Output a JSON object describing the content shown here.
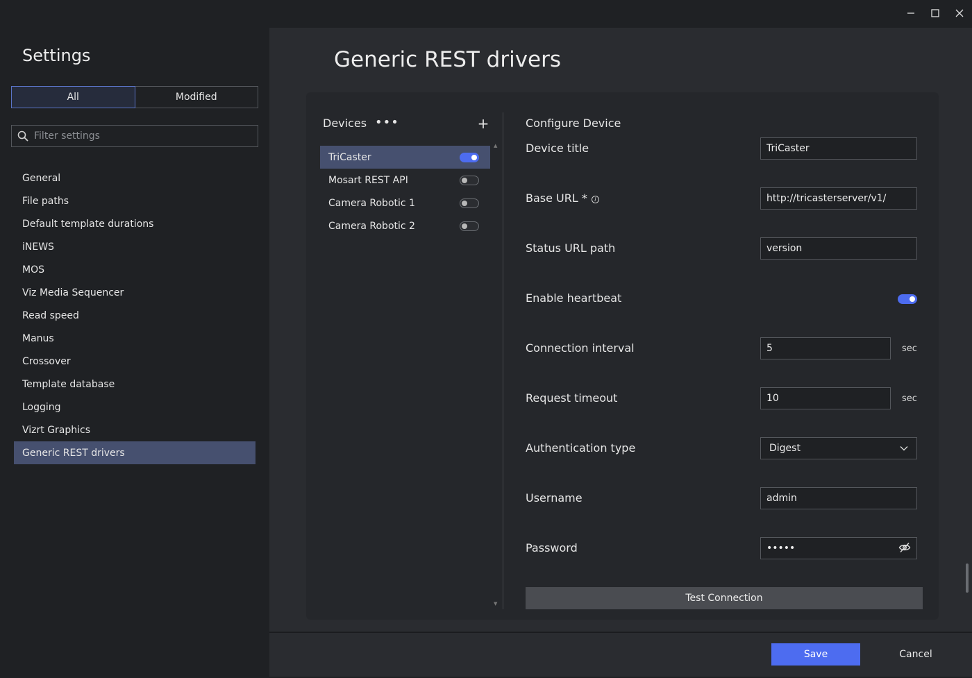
{
  "window": {
    "controls": {
      "minimize_icon": "minimize-icon",
      "maximize_icon": "maximize-icon",
      "close_icon": "close-icon"
    }
  },
  "sidebar": {
    "title": "Settings",
    "filter_tabs": [
      {
        "label": "All",
        "active": true
      },
      {
        "label": "Modified",
        "active": false
      }
    ],
    "filter": {
      "placeholder": "Filter settings",
      "value": ""
    },
    "items": [
      {
        "label": "General",
        "active": false
      },
      {
        "label": "File paths",
        "active": false
      },
      {
        "label": "Default template durations",
        "active": false
      },
      {
        "label": "iNEWS",
        "active": false
      },
      {
        "label": "MOS",
        "active": false
      },
      {
        "label": "Viz Media Sequencer",
        "active": false
      },
      {
        "label": "Read speed",
        "active": false
      },
      {
        "label": "Manus",
        "active": false
      },
      {
        "label": "Crossover",
        "active": false
      },
      {
        "label": "Template database",
        "active": false
      },
      {
        "label": "Logging",
        "active": false
      },
      {
        "label": "Vizrt Graphics",
        "active": false
      },
      {
        "label": "Generic REST drivers",
        "active": true
      }
    ]
  },
  "main": {
    "title": "Generic REST drivers",
    "devices": {
      "heading": "Devices",
      "more_label": "•••",
      "add_label": "+",
      "items": [
        {
          "name": "TriCaster",
          "enabled": true,
          "selected": true
        },
        {
          "name": "Mosart REST API",
          "enabled": false,
          "selected": false
        },
        {
          "name": "Camera Robotic 1",
          "enabled": false,
          "selected": false
        },
        {
          "name": "Camera Robotic 2",
          "enabled": false,
          "selected": false
        }
      ]
    },
    "configure": {
      "heading": "Configure Device",
      "device_title": {
        "label": "Device title",
        "value": "TriCaster"
      },
      "base_url": {
        "label": "Base URL *",
        "value": "http://tricasterserver/v1/"
      },
      "status_url": {
        "label": "Status URL path",
        "value": "version"
      },
      "heartbeat": {
        "label": "Enable heartbeat",
        "enabled": true
      },
      "connection_interval": {
        "label": "Connection interval",
        "value": "5",
        "unit": "sec"
      },
      "request_timeout": {
        "label": "Request timeout",
        "value": "10",
        "unit": "sec"
      },
      "auth_type": {
        "label": "Authentication type",
        "value": "Digest"
      },
      "username": {
        "label": "Username",
        "value": "admin"
      },
      "password": {
        "label": "Password",
        "value": "•••••"
      },
      "test_button": "Test Connection"
    }
  },
  "footer": {
    "save_label": "Save",
    "cancel_label": "Cancel"
  },
  "colors": {
    "accent": "#4d6cf0",
    "selection": "#46506f",
    "background": "#1f2124",
    "panel": "#2a2c30"
  }
}
